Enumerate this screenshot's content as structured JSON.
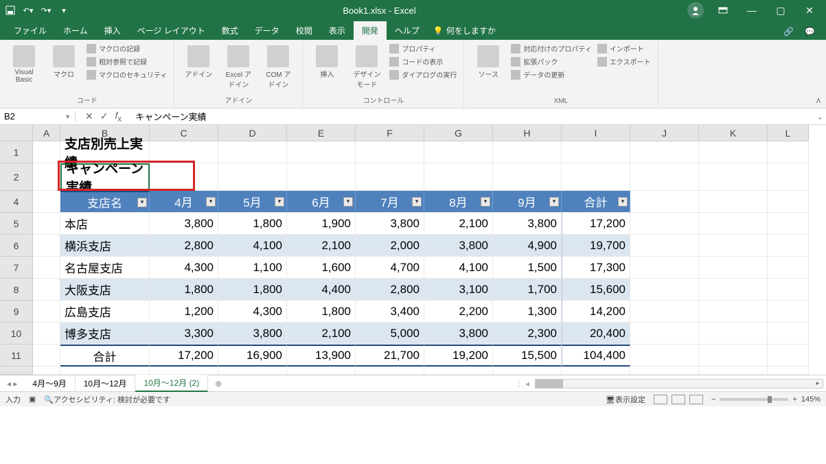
{
  "titlebar": {
    "title": "Book1.xlsx - Excel"
  },
  "tabs": {
    "items": [
      "ファイル",
      "ホーム",
      "挿入",
      "ページ レイアウト",
      "数式",
      "データ",
      "校閲",
      "表示",
      "開発",
      "ヘルプ"
    ],
    "active": "開発",
    "tell": "何をしますか"
  },
  "ribbon": {
    "code": {
      "vb": "Visual Basic",
      "macro": "マクロ",
      "rec": "マクロの記録",
      "rel": "相対参照で記録",
      "sec": "マクロのセキュリティ",
      "label": "コード"
    },
    "addins": {
      "a1": "アドイン",
      "a2": "Excel アドイン",
      "a3": "COM アドイン",
      "label": "アドイン"
    },
    "controls": {
      "insert": "挿入",
      "design": "デザイン モード",
      "prop": "プロパティ",
      "code": "コードの表示",
      "dlg": "ダイアログの実行",
      "label": "コントロール"
    },
    "xml": {
      "src": "ソース",
      "map": "対応付けのプロパティ",
      "ext": "拡張パック",
      "refresh": "データの更新",
      "imp": "インポート",
      "exp": "エクスポート",
      "label": "XML"
    }
  },
  "formula": {
    "ref": "B2",
    "value": "キャンペーン実績"
  },
  "columns": [
    "A",
    "B",
    "C",
    "D",
    "E",
    "F",
    "G",
    "H",
    "I",
    "J",
    "K",
    "L"
  ],
  "rows": [
    "1",
    "2",
    "4",
    "5",
    "6",
    "7",
    "8",
    "9",
    "10",
    "11"
  ],
  "b1": "支店別売上実績",
  "b2": "キャンペーン実績",
  "table": {
    "headers": [
      "支店名",
      "4月",
      "5月",
      "6月",
      "7月",
      "8月",
      "9月",
      "合計"
    ],
    "data": [
      [
        "本店",
        "3,800",
        "1,800",
        "1,900",
        "3,800",
        "2,100",
        "3,800",
        "17,200"
      ],
      [
        "横浜支店",
        "2,800",
        "4,100",
        "2,100",
        "2,000",
        "3,800",
        "4,900",
        "19,700"
      ],
      [
        "名古屋支店",
        "4,300",
        "1,100",
        "1,600",
        "4,700",
        "4,100",
        "1,500",
        "17,300"
      ],
      [
        "大阪支店",
        "1,800",
        "1,800",
        "4,400",
        "2,800",
        "3,100",
        "1,700",
        "15,600"
      ],
      [
        "広島支店",
        "1,200",
        "4,300",
        "1,800",
        "3,400",
        "2,200",
        "1,300",
        "14,200"
      ],
      [
        "博多支店",
        "3,300",
        "3,800",
        "2,100",
        "5,000",
        "3,800",
        "2,300",
        "20,400"
      ]
    ],
    "total_label": "合計",
    "totals": [
      "17,200",
      "16,900",
      "13,900",
      "21,700",
      "19,200",
      "15,500",
      "104,400"
    ]
  },
  "sheets": {
    "items": [
      "4月～9月",
      "10月～12月",
      "10月～12月 (2)"
    ],
    "active": 2
  },
  "status": {
    "mode": "入力",
    "access": "アクセシビリティ: 検討が必要です",
    "display": "表示設定",
    "zoom": "145%"
  }
}
